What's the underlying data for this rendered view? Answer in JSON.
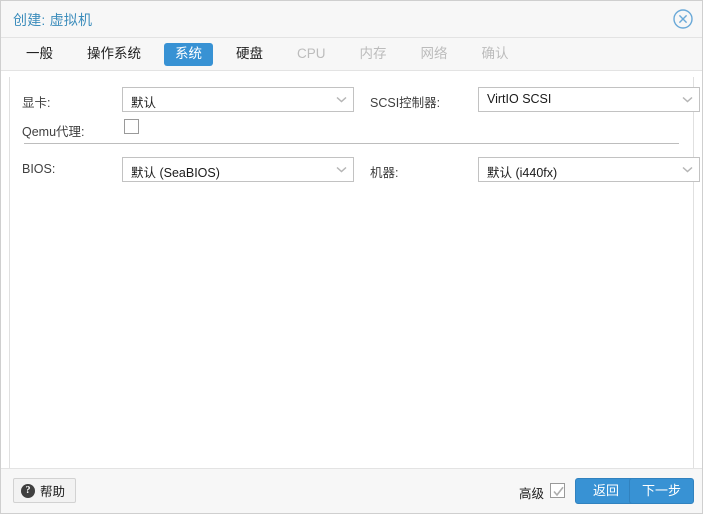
{
  "window": {
    "title": "创建: 虚拟机",
    "close_icon": "close-circle-icon"
  },
  "tabs": [
    {
      "label": "一般",
      "state": "normal"
    },
    {
      "label": "操作系统",
      "state": "normal"
    },
    {
      "label": "系统",
      "state": "active"
    },
    {
      "label": "硬盘",
      "state": "normal"
    },
    {
      "label": "CPU",
      "state": "disabled"
    },
    {
      "label": "内存",
      "state": "disabled"
    },
    {
      "label": "网络",
      "state": "disabled"
    },
    {
      "label": "确认",
      "state": "disabled"
    }
  ],
  "form": {
    "graphic_card": {
      "label": "显卡:",
      "value": "默认",
      "chevron": "chevron-down-icon"
    },
    "scsi_controller": {
      "label": "SCSI控制器:",
      "value": "VirtIO SCSI",
      "chevron": "chevron-down-icon"
    },
    "qemu_agent": {
      "label": "Qemu代理:",
      "checked": false
    },
    "bios": {
      "label": "BIOS:",
      "value": "默认 (SeaBIOS)",
      "chevron": "chevron-down-icon"
    },
    "machine": {
      "label": "机器:",
      "value": "默认 (i440fx)",
      "chevron": "chevron-down-icon"
    }
  },
  "footer": {
    "help_label": "帮助",
    "help_icon": "question-mark-circle-icon",
    "advanced_label": "高级",
    "advanced_checked": true,
    "back_label": "返回",
    "next_label": "下一步"
  },
  "colors": {
    "accent": "#3892d4",
    "title_text": "#3c8dbc",
    "disabled_tab": "#bcbcbc",
    "panel_border": "#e0e0e0",
    "chrome_bg": "#f7f7f7"
  }
}
